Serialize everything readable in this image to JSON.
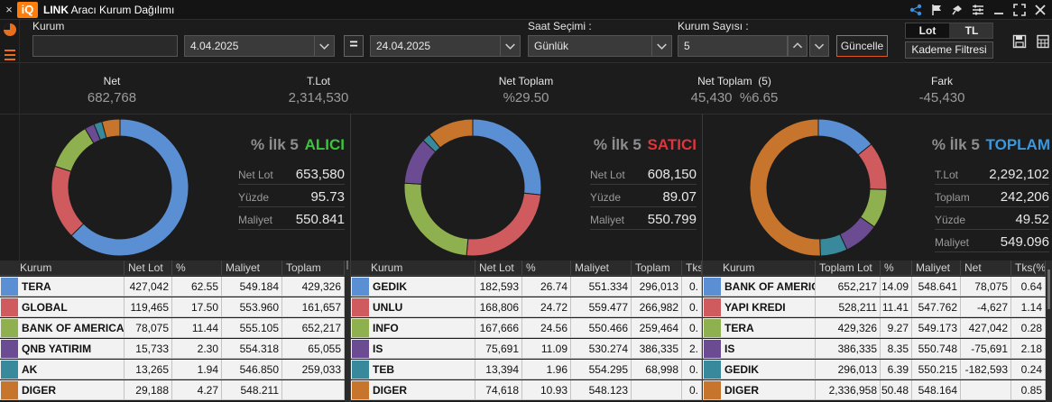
{
  "window": {
    "logo": "iQ",
    "title_bold": "LINK",
    "title_rest": "Aracı Kurum Dağılımı",
    "close": "×"
  },
  "controls": {
    "kurum_label": "Kurum",
    "kurum_value": "",
    "start_date": "4.04.2025",
    "equals": "=",
    "end_date": "24.04.2025",
    "saat_label": "Saat Seçimi :",
    "saat_value": "Günlük",
    "kurum_sayisi_label": "Kurum Sayısı :",
    "kurum_sayisi_value": "5",
    "update_button": "Güncelle",
    "lot_button": "Lot",
    "tl_button": "TL",
    "kademe_button": "Kademe Filtresi"
  },
  "summary": [
    {
      "label": "Net",
      "value": "682,768"
    },
    {
      "label": "T.Lot",
      "value": "2,314,530"
    },
    {
      "label": "Net Toplam",
      "value": "%29.50"
    },
    {
      "label": "Net Toplam  (5)",
      "value": "45,430  %6.65"
    },
    {
      "label": "Fark",
      "value": "-45,430"
    }
  ],
  "colors": {
    "blue": "#5b8fd4",
    "red": "#cf5b5f",
    "green": "#8fb04e",
    "purple": "#6b4c93",
    "teal": "#37899b",
    "orange": "#c7742d",
    "alici": "#3cc43c",
    "satici": "#e0353a",
    "toplam": "#3a98de"
  },
  "alici": {
    "title_prefix": "% İlk 5",
    "title_accent": "ALICI",
    "stats": [
      {
        "label": "Net Lot",
        "value": "653,580"
      },
      {
        "label": "Yüzde",
        "value": "95.73"
      },
      {
        "label": "Maliyet",
        "value": "550.841"
      }
    ],
    "donut": [
      {
        "name": "TERA",
        "value": 62.55,
        "color": "blue"
      },
      {
        "name": "GLOBAL",
        "value": 17.5,
        "color": "red"
      },
      {
        "name": "BANK OF AMERICA",
        "value": 11.44,
        "color": "green"
      },
      {
        "name": "QNB YATIRIM",
        "value": 2.3,
        "color": "purple"
      },
      {
        "name": "AK",
        "value": 1.94,
        "color": "teal"
      },
      {
        "name": "DIGER",
        "value": 4.27,
        "color": "orange"
      }
    ],
    "columns": [
      "Kurum",
      "Net Lot",
      "%",
      "Maliyet",
      "Toplam"
    ],
    "rows": [
      {
        "color": "blue",
        "cells": [
          "TERA",
          "427,042",
          "62.55",
          "549.184",
          "429,326"
        ]
      },
      {
        "color": "red",
        "cells": [
          "GLOBAL",
          "119,465",
          "17.50",
          "553.960",
          "161,657"
        ]
      },
      {
        "color": "green",
        "cells": [
          "BANK OF AMERICA",
          "78,075",
          "11.44",
          "555.105",
          "652,217"
        ]
      },
      {
        "color": "purple",
        "cells": [
          "QNB YATIRIM",
          "15,733",
          "2.30",
          "554.318",
          "65,055"
        ]
      },
      {
        "color": "teal",
        "cells": [
          "AK",
          "13,265",
          "1.94",
          "546.850",
          "259,033"
        ]
      },
      {
        "color": "orange",
        "cells": [
          "DIGER",
          "29,188",
          "4.27",
          "548.211",
          ""
        ]
      }
    ]
  },
  "satici": {
    "title_prefix": "% İlk 5",
    "title_accent": "SATICI",
    "stats": [
      {
        "label": "Net Lot",
        "value": "608,150"
      },
      {
        "label": "Yüzde",
        "value": "89.07"
      },
      {
        "label": "Maliyet",
        "value": "550.799"
      }
    ],
    "donut": [
      {
        "name": "GEDIK",
        "value": 26.74,
        "color": "blue"
      },
      {
        "name": "UNLU",
        "value": 24.72,
        "color": "red"
      },
      {
        "name": "INFO",
        "value": 24.56,
        "color": "green"
      },
      {
        "name": "IS",
        "value": 11.09,
        "color": "purple"
      },
      {
        "name": "TEB",
        "value": 1.96,
        "color": "teal"
      },
      {
        "name": "DIGER",
        "value": 10.93,
        "color": "orange"
      }
    ],
    "columns": [
      "Kurum",
      "Net Lot",
      "%",
      "Maliyet",
      "Toplam",
      "Tks(%"
    ],
    "rows": [
      {
        "color": "blue",
        "cells": [
          "GEDIK",
          "182,593",
          "26.74",
          "551.334",
          "296,013",
          "0."
        ]
      },
      {
        "color": "red",
        "cells": [
          "UNLU",
          "168,806",
          "24.72",
          "559.477",
          "266,982",
          "0."
        ]
      },
      {
        "color": "green",
        "cells": [
          "INFO",
          "167,666",
          "24.56",
          "550.466",
          "259,464",
          "0."
        ]
      },
      {
        "color": "purple",
        "cells": [
          "IS",
          "75,691",
          "11.09",
          "530.274",
          "386,335",
          "2."
        ]
      },
      {
        "color": "teal",
        "cells": [
          "TEB",
          "13,394",
          "1.96",
          "554.295",
          "68,998",
          "0."
        ]
      },
      {
        "color": "orange",
        "cells": [
          "DIGER",
          "74,618",
          "10.93",
          "548.123",
          "",
          "0."
        ]
      }
    ]
  },
  "toplam": {
    "title_prefix": "% İlk 5",
    "title_accent": "TOPLAM",
    "stats": [
      {
        "label": "T.Lot",
        "value": "2,292,102"
      },
      {
        "label": "Toplam",
        "value": "242,206"
      },
      {
        "label": "Yüzde",
        "value": "49.52"
      },
      {
        "label": "Maliyet",
        "value": "549.096"
      }
    ],
    "donut": [
      {
        "name": "BANK OF AMERICA",
        "value": 14.09,
        "color": "blue"
      },
      {
        "name": "YAPI KREDI",
        "value": 11.41,
        "color": "red"
      },
      {
        "name": "TERA",
        "value": 9.27,
        "color": "green"
      },
      {
        "name": "IS",
        "value": 8.35,
        "color": "purple"
      },
      {
        "name": "GEDIK",
        "value": 6.39,
        "color": "teal"
      },
      {
        "name": "DIGER",
        "value": 50.48,
        "color": "orange"
      }
    ],
    "columns": [
      "Kurum",
      "Toplam Lot",
      "%",
      "Maliyet",
      "Net",
      "Tks(%)"
    ],
    "rows": [
      {
        "color": "blue",
        "cells": [
          "BANK OF AMERIC",
          "652,217",
          "14.09",
          "548.641",
          "78,075",
          "0.64"
        ]
      },
      {
        "color": "red",
        "cells": [
          "YAPI KREDI",
          "528,211",
          "11.41",
          "547.762",
          "-4,627",
          "1.14"
        ]
      },
      {
        "color": "green",
        "cells": [
          "TERA",
          "429,326",
          "9.27",
          "549.173",
          "427,042",
          "0.28"
        ]
      },
      {
        "color": "purple",
        "cells": [
          "IS",
          "386,335",
          "8.35",
          "550.748",
          "-75,691",
          "2.18"
        ]
      },
      {
        "color": "teal",
        "cells": [
          "GEDIK",
          "296,013",
          "6.39",
          "550.215",
          "-182,593",
          "0.24"
        ]
      },
      {
        "color": "orange",
        "cells": [
          "DIGER",
          "2,336,958",
          "50.48",
          "548.164",
          "",
          "0.85"
        ]
      }
    ]
  }
}
